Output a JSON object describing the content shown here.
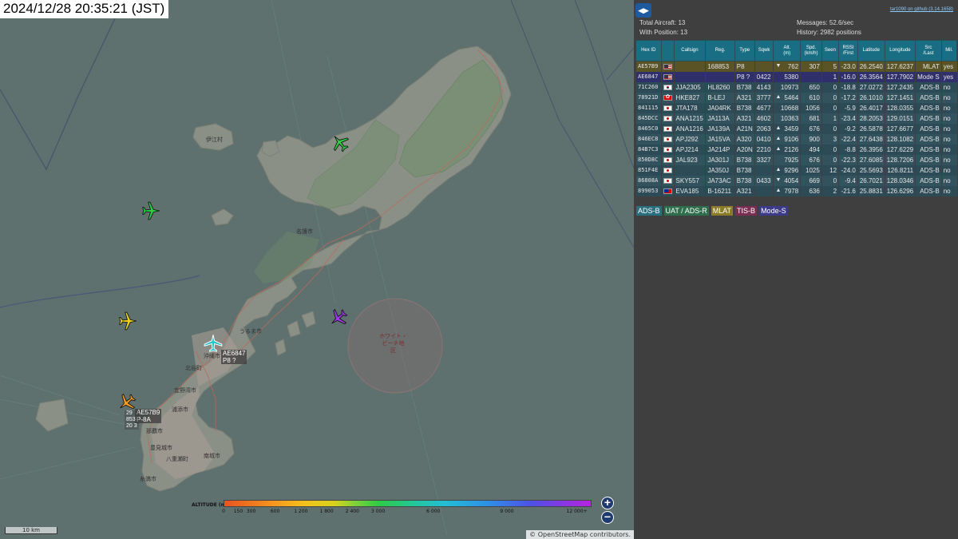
{
  "clock": "2024/12/28 20:35:21 (JST)",
  "map": {
    "place_labels": [
      "名護市",
      "うるま市",
      "沖縄市",
      "浦添市",
      "那覇市",
      "豊見城市",
      "八重瀬町",
      "南城市",
      "糸満市",
      "宜野湾市",
      "北谷町",
      "伊江村"
    ],
    "zone_label": "ホワイト・\nビーチ地\n区",
    "selected_label": [
      "AE6847",
      "P8 ?"
    ],
    "mlat_label": [
      "AE57B9",
      "P-8A"
    ],
    "mlat_sub": [
      "29",
      "853",
      "20 3"
    ],
    "legend_title": "ALTITUDE (m)",
    "legend_ticks": [
      "0",
      "150",
      "300",
      "600",
      "1 200",
      "1 800",
      "2 400",
      "3 000",
      "6 000",
      "9 000",
      "12 000+"
    ],
    "scale_label": "10 km",
    "attribution": "© OpenStreetMap contributors.",
    "zoom_in": "+",
    "zoom_out": "−",
    "colors": {
      "water": "#5f716e",
      "land": "#8a8f86"
    }
  },
  "sidebar": {
    "toggle_icon": "◀▶",
    "version": "tar1090 on github (3.14.1658)",
    "total_aircraft": "Total Aircraft: 13",
    "with_position": "With Position: 13",
    "messages": "Messages: 52.6/sec",
    "history": "History: 2982 positions",
    "columns": [
      "Hex ID",
      "",
      "Callsign",
      "Reg.",
      "Type",
      "Sqwk",
      "Alt.\n(m)",
      "Spd.\n(km/h)",
      "Seen",
      "RSSI\n/First",
      "Latitude",
      "Longitude",
      "Src\n/Last",
      "Mil."
    ],
    "rows": [
      {
        "hex": "AE57B9",
        "flag": "us",
        "callsign": "",
        "reg": "168853",
        "type": "P8",
        "sqwk": "",
        "trend": "▼",
        "alt": "762",
        "spd": "307",
        "seen": "5",
        "rssi": "-23.0",
        "lat": "26.2540",
        "lon": "127.6237",
        "src": "MLAT",
        "mil": "yes",
        "kind": "mlat"
      },
      {
        "hex": "AE6847",
        "flag": "us",
        "callsign": "",
        "reg": "",
        "type": "P8 ?",
        "sqwk": "0422",
        "trend": "",
        "alt": "5380",
        "spd": "",
        "seen": "1",
        "rssi": "-16.0",
        "lat": "26.3564",
        "lon": "127.7902",
        "src": "Mode S",
        "mil": "yes",
        "kind": "modes"
      },
      {
        "hex": "71C260",
        "flag": "kr",
        "callsign": "JJA2305",
        "reg": "HL8260",
        "type": "B738",
        "sqwk": "4143",
        "trend": "",
        "alt": "10973",
        "spd": "650",
        "seen": "0",
        "rssi": "-18.8",
        "lat": "27.0272",
        "lon": "127.2435",
        "src": "ADS-B",
        "mil": "no",
        "kind": "adsb"
      },
      {
        "hex": "78921D",
        "flag": "hk",
        "callsign": "HKE827",
        "reg": "B-LEJ",
        "type": "A321",
        "sqwk": "3777",
        "trend": "▲",
        "alt": "5464",
        "spd": "610",
        "seen": "0",
        "rssi": "-17.2",
        "lat": "26.1010",
        "lon": "127.1451",
        "src": "ADS-B",
        "mil": "no",
        "kind": "adsb"
      },
      {
        "hex": "841115",
        "flag": "jp",
        "callsign": "JTA178",
        "reg": "JA04RK",
        "type": "B738",
        "sqwk": "4677",
        "trend": "",
        "alt": "10668",
        "spd": "1056",
        "seen": "0",
        "rssi": "-5.9",
        "lat": "26.4017",
        "lon": "128.0355",
        "src": "ADS-B",
        "mil": "no",
        "kind": "adsb"
      },
      {
        "hex": "845DCC",
        "flag": "jp",
        "callsign": "ANA1215",
        "reg": "JA113A",
        "type": "A321",
        "sqwk": "4602",
        "trend": "",
        "alt": "10363",
        "spd": "681",
        "seen": "1",
        "rssi": "-23.4",
        "lat": "28.2053",
        "lon": "129.0151",
        "src": "ADS-B",
        "mil": "no",
        "kind": "adsb"
      },
      {
        "hex": "8465C0",
        "flag": "jp",
        "callsign": "ANA1216",
        "reg": "JA139A",
        "type": "A21N",
        "sqwk": "2063",
        "trend": "▲",
        "alt": "3459",
        "spd": "676",
        "seen": "0",
        "rssi": "-9.2",
        "lat": "26.5878",
        "lon": "127.6677",
        "src": "ADS-B",
        "mil": "no",
        "kind": "adsb"
      },
      {
        "hex": "846EC8",
        "flag": "jp",
        "callsign": "APJ292",
        "reg": "JA15VA",
        "type": "A320",
        "sqwk": "0410",
        "trend": "▲",
        "alt": "9106",
        "spd": "900",
        "seen": "3",
        "rssi": "-22.4",
        "lat": "27.6438",
        "lon": "128.1082",
        "src": "ADS-B",
        "mil": "no",
        "kind": "adsb"
      },
      {
        "hex": "84B7C3",
        "flag": "jp",
        "callsign": "APJ214",
        "reg": "JA214P",
        "type": "A20N",
        "sqwk": "2210",
        "trend": "▲",
        "alt": "2126",
        "spd": "494",
        "seen": "0",
        "rssi": "-8.8",
        "lat": "26.3956",
        "lon": "127.6229",
        "src": "ADS-B",
        "mil": "no",
        "kind": "adsb"
      },
      {
        "hex": "850D8C",
        "flag": "jp",
        "callsign": "JAL923",
        "reg": "JA301J",
        "type": "B738",
        "sqwk": "3327",
        "trend": "",
        "alt": "7925",
        "spd": "676",
        "seen": "0",
        "rssi": "-22.3",
        "lat": "27.6085",
        "lon": "128.7206",
        "src": "ADS-B",
        "mil": "no",
        "kind": "adsb"
      },
      {
        "hex": "851F4E",
        "flag": "jp",
        "callsign": "",
        "reg": "JA350J",
        "type": "B738",
        "sqwk": "",
        "trend": "▲",
        "alt": "9296",
        "spd": "1025",
        "seen": "12",
        "rssi": "-24.0",
        "lat": "25.5693",
        "lon": "126.8211",
        "src": "ADS-B",
        "mil": "no",
        "kind": "adsb"
      },
      {
        "hex": "86808A",
        "flag": "jp",
        "callsign": "SKY557",
        "reg": "JA73AC",
        "type": "B738",
        "sqwk": "0433",
        "trend": "▼",
        "alt": "4054",
        "spd": "669",
        "seen": "0",
        "rssi": "-9.4",
        "lat": "26.7021",
        "lon": "128.0346",
        "src": "ADS-B",
        "mil": "no",
        "kind": "adsb"
      },
      {
        "hex": "899053",
        "flag": "tw",
        "callsign": "EVA185",
        "reg": "B-16211",
        "type": "A321",
        "sqwk": "",
        "trend": "▲",
        "alt": "7978",
        "spd": "636",
        "seen": "2",
        "rssi": "-21.6",
        "lat": "25.8831",
        "lon": "126.6296",
        "src": "ADS-B",
        "mil": "no",
        "kind": "adsb"
      }
    ],
    "source_legend": [
      {
        "label": "ADS-B",
        "color": "#2b6f7e"
      },
      {
        "label": "UAT / ADS-R",
        "color": "#2e6e4c"
      },
      {
        "label": "MLAT",
        "color": "#8a7a2a"
      },
      {
        "label": "TIS-B",
        "color": "#7a2e52"
      },
      {
        "label": "Mode-S",
        "color": "#3b3b8a"
      }
    ]
  }
}
